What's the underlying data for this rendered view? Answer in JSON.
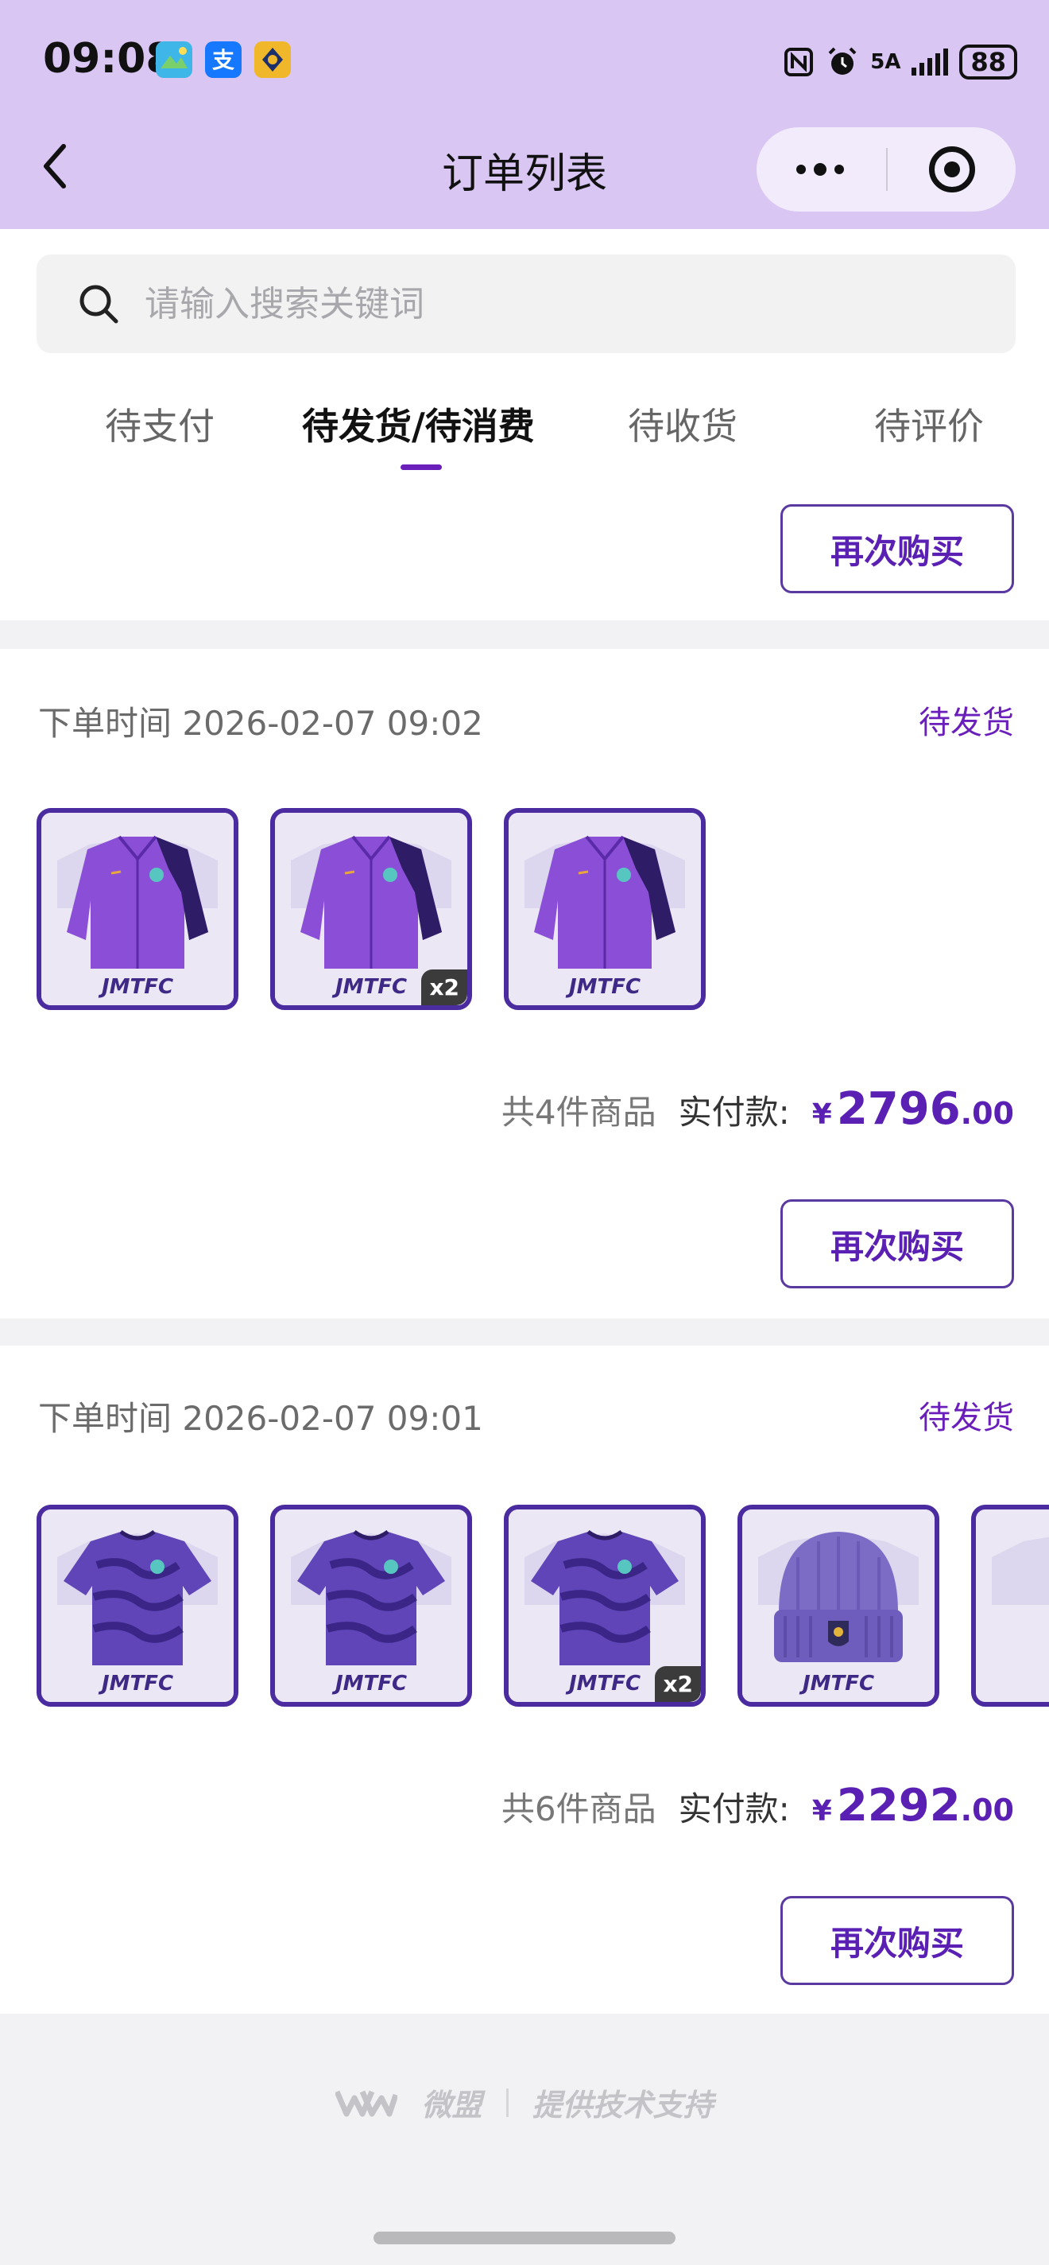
{
  "status_bar": {
    "time": "09:08",
    "network": "5A",
    "battery": "88",
    "app_icons": [
      "mini-app-icon",
      "alipay-icon",
      "app-icon"
    ],
    "app_icon_colors": [
      "#3fb6e8",
      "#1677ff",
      "#f0b72a"
    ],
    "alipay_glyph": "支"
  },
  "nav": {
    "title": "订单列表"
  },
  "search": {
    "placeholder": "请输入搜索关键词",
    "value": ""
  },
  "tabs": [
    {
      "label": "待支付",
      "active": false
    },
    {
      "label": "待发货/待消费",
      "active": true
    },
    {
      "label": "待收货",
      "active": false
    },
    {
      "label": "待评价",
      "active": false
    }
  ],
  "rebuy_label": "再次购买",
  "accent_color": "#6a1fbb",
  "orders": [
    {
      "time": "下单时间 2026-02-07 09:02",
      "status": "待发货",
      "products": [
        {
          "type": "jacket",
          "brand": "JMTFC",
          "qty": ""
        },
        {
          "type": "jacket",
          "brand": "JMTFC",
          "qty": "x2"
        },
        {
          "type": "jacket",
          "brand": "JMTFC",
          "qty": ""
        }
      ],
      "count_text": "共4件商品",
      "paid_label": "实付款:",
      "currency": "¥",
      "price_int": "2796",
      "price_dec": ".00"
    },
    {
      "time": "下单时间 2026-02-07 09:01",
      "status": "待发货",
      "products": [
        {
          "type": "jersey",
          "brand": "JMTFC",
          "qty": ""
        },
        {
          "type": "jersey",
          "brand": "JMTFC",
          "qty": ""
        },
        {
          "type": "jersey",
          "brand": "JMTFC",
          "qty": "x2"
        },
        {
          "type": "beanie",
          "brand": "JMTFC",
          "qty": ""
        },
        {
          "type": "partial",
          "brand": "",
          "qty": ""
        }
      ],
      "count_text": "共6件商品",
      "paid_label": "实付款:",
      "currency": "¥",
      "price_int": "2292",
      "price_dec": ".00"
    }
  ],
  "footer": {
    "brand": "微盟",
    "support": "提供技术支持"
  }
}
